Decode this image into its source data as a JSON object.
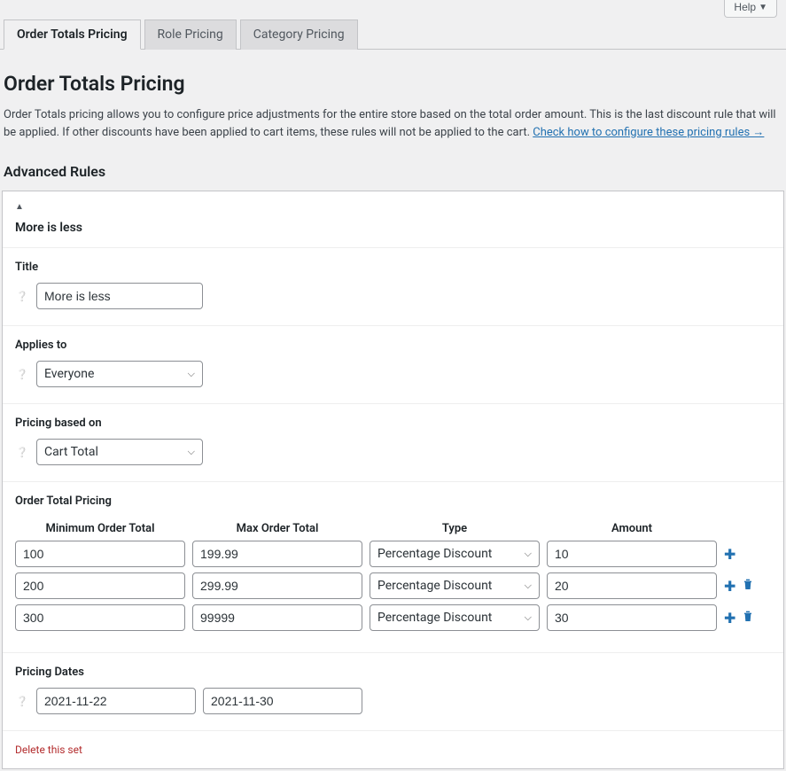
{
  "help_button": "Help",
  "tabs": {
    "order_totals": "Order Totals Pricing",
    "role": "Role Pricing",
    "category": "Category Pricing"
  },
  "page_title": "Order Totals Pricing",
  "description_text": "Order Totals pricing allows you to configure price adjustments for the entire store based on the total order amount. This is the last discount rule that will be applied. If other discounts have been applied to cart items, these rules will not be applied to the cart. ",
  "description_link": "Check how to configure these pricing rules →",
  "section_title": "Advanced Rules",
  "rule": {
    "name": "More is less",
    "title_label": "Title",
    "title_value": "More is less",
    "applies_label": "Applies to",
    "applies_value": "Everyone",
    "based_label": "Pricing based on",
    "based_value": "Cart Total",
    "pricing_label": "Order Total Pricing",
    "headers": {
      "min": "Minimum Order Total",
      "max": "Max Order Total",
      "type": "Type",
      "amount": "Amount"
    },
    "rows": [
      {
        "min": "100",
        "max": "199.99",
        "type": "Percentage Discount",
        "amount": "10",
        "can_delete": false
      },
      {
        "min": "200",
        "max": "299.99",
        "type": "Percentage Discount",
        "amount": "20",
        "can_delete": true
      },
      {
        "min": "300",
        "max": "99999",
        "type": "Percentage Discount",
        "amount": "30",
        "can_delete": true
      }
    ],
    "dates_label": "Pricing Dates",
    "date_from": "2021-11-22",
    "date_to": "2021-11-30",
    "delete_text": "Delete this set"
  }
}
